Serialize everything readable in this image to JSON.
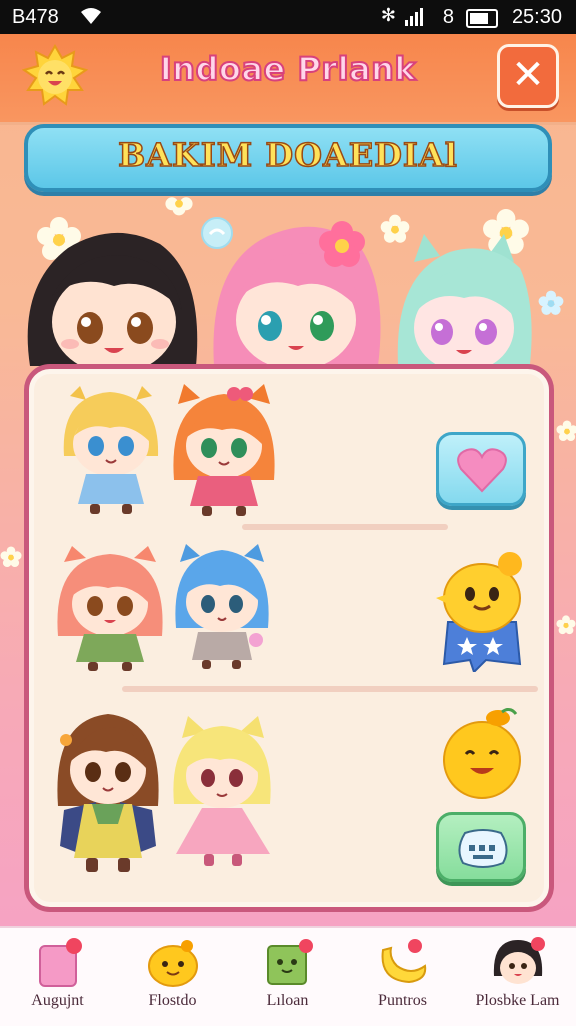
{
  "status_bar": {
    "carrier": "B478",
    "battery_level": "8",
    "time": "25:30"
  },
  "header": {
    "title": "Indoae Prlank",
    "close_label": "✕"
  },
  "banner": {
    "label": "BAKIM DOAEDIAl"
  },
  "panel": {
    "rows": [
      {
        "characters": [
          "blonde-blue-dress-chibi",
          "orange-hair-pink-dress-chibi"
        ],
        "action_icon": "heart-icon"
      },
      {
        "characters": [
          "pink-hair-green-dress-chibi",
          "blue-hair-grey-dress-chibi"
        ],
        "action_icon": "yellow-chick-mascot-icon"
      },
      {
        "characters": [
          "brown-hair-green-dress-chibi",
          "yellow-hair-pink-dress-chibi"
        ],
        "action_icon": "smiling-orange-mascot-icon"
      }
    ]
  },
  "bottom_nav": {
    "items": [
      {
        "label": "Augujnt",
        "icon": "pink-card-icon"
      },
      {
        "label": "Flostdo",
        "icon": "yellow-blob-icon"
      },
      {
        "label": "Lıloan",
        "icon": "green-box-icon"
      },
      {
        "label": "Puntros",
        "icon": "banana-icon"
      },
      {
        "label": "Plosbke Lam",
        "icon": "chibi-face-icon"
      }
    ]
  },
  "colors": {
    "header": "#f7864c",
    "banner": "#5cc7e8",
    "panel_border": "#c9587c",
    "title_stroke": "#d8417c"
  }
}
